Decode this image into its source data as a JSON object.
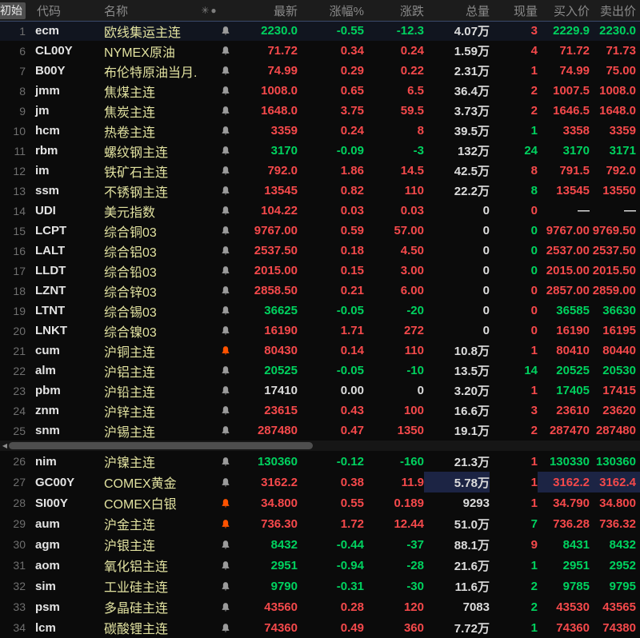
{
  "colors": {
    "up": "#f5494b",
    "down": "#00d25f",
    "neutral": "#dcdcdc",
    "name_text": "#e2e2a0",
    "alert_bell": "#ff5300",
    "highlight_bg": "#1c2444"
  },
  "header": {
    "initial": "初始",
    "code": "代码",
    "name": "名称",
    "mode_icon": "✳●",
    "last": "最新",
    "pct": "涨幅%",
    "chg": "涨跌",
    "vol": "总量",
    "cur": "现量",
    "bid": "买入价",
    "ask": "卖出价"
  },
  "scrollbar": {
    "arrow_left": "◀"
  },
  "rows_top": [
    {
      "num": "1",
      "code": "ecm",
      "name": "欧线集运主连",
      "bell": "normal",
      "selected": true,
      "values": [
        [
          "2230.0",
          "d"
        ],
        [
          "-0.55",
          "d"
        ],
        [
          "-12.3",
          "d"
        ],
        [
          "4.07万",
          "n"
        ],
        [
          "3",
          "u"
        ],
        [
          "2229.9",
          "d"
        ],
        [
          "2230.0",
          "d"
        ]
      ]
    },
    {
      "num": "6",
      "code": "CL00Y",
      "name": "NYMEX原油",
      "bell": "normal",
      "values": [
        [
          "71.72",
          "u"
        ],
        [
          "0.34",
          "u"
        ],
        [
          "0.24",
          "u"
        ],
        [
          "1.59万",
          "n"
        ],
        [
          "4",
          "u"
        ],
        [
          "71.72",
          "u"
        ],
        [
          "71.73",
          "u"
        ]
      ]
    },
    {
      "num": "7",
      "code": "B00Y",
      "name": "布伦特原油当月...",
      "bell": "normal",
      "values": [
        [
          "74.99",
          "u"
        ],
        [
          "0.29",
          "u"
        ],
        [
          "0.22",
          "u"
        ],
        [
          "2.31万",
          "n"
        ],
        [
          "1",
          "u"
        ],
        [
          "74.99",
          "u"
        ],
        [
          "75.00",
          "u"
        ]
      ]
    },
    {
      "num": "8",
      "code": "jmm",
      "name": "焦煤主连",
      "bell": "normal",
      "values": [
        [
          "1008.0",
          "u"
        ],
        [
          "0.65",
          "u"
        ],
        [
          "6.5",
          "u"
        ],
        [
          "36.4万",
          "n"
        ],
        [
          "2",
          "u"
        ],
        [
          "1007.5",
          "u"
        ],
        [
          "1008.0",
          "u"
        ]
      ]
    },
    {
      "num": "9",
      "code": "jm",
      "name": "焦炭主连",
      "bell": "normal",
      "values": [
        [
          "1648.0",
          "u"
        ],
        [
          "3.75",
          "u"
        ],
        [
          "59.5",
          "u"
        ],
        [
          "3.73万",
          "n"
        ],
        [
          "2",
          "u"
        ],
        [
          "1646.5",
          "u"
        ],
        [
          "1648.0",
          "u"
        ]
      ]
    },
    {
      "num": "10",
      "code": "hcm",
      "name": "热卷主连",
      "bell": "normal",
      "values": [
        [
          "3359",
          "u"
        ],
        [
          "0.24",
          "u"
        ],
        [
          "8",
          "u"
        ],
        [
          "39.5万",
          "n"
        ],
        [
          "1",
          "d"
        ],
        [
          "3358",
          "u"
        ],
        [
          "3359",
          "u"
        ]
      ]
    },
    {
      "num": "11",
      "code": "rbm",
      "name": "螺纹钢主连",
      "bell": "normal",
      "values": [
        [
          "3170",
          "d"
        ],
        [
          "-0.09",
          "d"
        ],
        [
          "-3",
          "d"
        ],
        [
          "132万",
          "n"
        ],
        [
          "24",
          "d"
        ],
        [
          "3170",
          "d"
        ],
        [
          "3171",
          "d"
        ]
      ]
    },
    {
      "num": "12",
      "code": "im",
      "name": "铁矿石主连",
      "bell": "normal",
      "values": [
        [
          "792.0",
          "u"
        ],
        [
          "1.86",
          "u"
        ],
        [
          "14.5",
          "u"
        ],
        [
          "42.5万",
          "n"
        ],
        [
          "8",
          "u"
        ],
        [
          "791.5",
          "u"
        ],
        [
          "792.0",
          "u"
        ]
      ]
    },
    {
      "num": "13",
      "code": "ssm",
      "name": "不锈钢主连",
      "bell": "normal",
      "values": [
        [
          "13545",
          "u"
        ],
        [
          "0.82",
          "u"
        ],
        [
          "110",
          "u"
        ],
        [
          "22.2万",
          "n"
        ],
        [
          "8",
          "d"
        ],
        [
          "13545",
          "u"
        ],
        [
          "13550",
          "u"
        ]
      ]
    },
    {
      "num": "14",
      "code": "UDI",
      "name": "美元指数",
      "bell": "normal",
      "values": [
        [
          "104.22",
          "u"
        ],
        [
          "0.03",
          "u"
        ],
        [
          "0.03",
          "u"
        ],
        [
          "0",
          "n"
        ],
        [
          "0",
          "u"
        ],
        [
          "—",
          "n"
        ],
        [
          "—",
          "n"
        ]
      ]
    },
    {
      "num": "15",
      "code": "LCPT",
      "name": "综合铜03",
      "bell": "normal",
      "values": [
        [
          "9767.00",
          "u"
        ],
        [
          "0.59",
          "u"
        ],
        [
          "57.00",
          "u"
        ],
        [
          "0",
          "n"
        ],
        [
          "0",
          "d"
        ],
        [
          "9767.00",
          "u"
        ],
        [
          "9769.50",
          "u"
        ]
      ]
    },
    {
      "num": "16",
      "code": "LALT",
      "name": "综合铝03",
      "bell": "normal",
      "values": [
        [
          "2537.50",
          "u"
        ],
        [
          "0.18",
          "u"
        ],
        [
          "4.50",
          "u"
        ],
        [
          "0",
          "n"
        ],
        [
          "0",
          "d"
        ],
        [
          "2537.00",
          "u"
        ],
        [
          "2537.50",
          "u"
        ]
      ]
    },
    {
      "num": "17",
      "code": "LLDT",
      "name": "综合铅03",
      "bell": "normal",
      "values": [
        [
          "2015.00",
          "u"
        ],
        [
          "0.15",
          "u"
        ],
        [
          "3.00",
          "u"
        ],
        [
          "0",
          "n"
        ],
        [
          "0",
          "d"
        ],
        [
          "2015.00",
          "u"
        ],
        [
          "2015.50",
          "u"
        ]
      ]
    },
    {
      "num": "18",
      "code": "LZNT",
      "name": "综合锌03",
      "bell": "normal",
      "values": [
        [
          "2858.50",
          "u"
        ],
        [
          "0.21",
          "u"
        ],
        [
          "6.00",
          "u"
        ],
        [
          "0",
          "n"
        ],
        [
          "0",
          "u"
        ],
        [
          "2857.00",
          "u"
        ],
        [
          "2859.00",
          "u"
        ]
      ]
    },
    {
      "num": "19",
      "code": "LTNT",
      "name": "综合锡03",
      "bell": "normal",
      "values": [
        [
          "36625",
          "d"
        ],
        [
          "-0.05",
          "d"
        ],
        [
          "-20",
          "d"
        ],
        [
          "0",
          "n"
        ],
        [
          "0",
          "u"
        ],
        [
          "36585",
          "d"
        ],
        [
          "36630",
          "d"
        ]
      ]
    },
    {
      "num": "20",
      "code": "LNKT",
      "name": "综合镍03",
      "bell": "normal",
      "values": [
        [
          "16190",
          "u"
        ],
        [
          "1.71",
          "u"
        ],
        [
          "272",
          "u"
        ],
        [
          "0",
          "n"
        ],
        [
          "0",
          "u"
        ],
        [
          "16190",
          "u"
        ],
        [
          "16195",
          "u"
        ]
      ]
    },
    {
      "num": "21",
      "code": "cum",
      "name": "沪铜主连",
      "bell": "alert",
      "values": [
        [
          "80430",
          "u"
        ],
        [
          "0.14",
          "u"
        ],
        [
          "110",
          "u"
        ],
        [
          "10.8万",
          "n"
        ],
        [
          "1",
          "u"
        ],
        [
          "80410",
          "u"
        ],
        [
          "80440",
          "u"
        ]
      ]
    },
    {
      "num": "22",
      "code": "alm",
      "name": "沪铝主连",
      "bell": "normal",
      "values": [
        [
          "20525",
          "d"
        ],
        [
          "-0.05",
          "d"
        ],
        [
          "-10",
          "d"
        ],
        [
          "13.5万",
          "n"
        ],
        [
          "14",
          "d"
        ],
        [
          "20525",
          "d"
        ],
        [
          "20530",
          "d"
        ]
      ]
    },
    {
      "num": "23",
      "code": "pbm",
      "name": "沪铅主连",
      "bell": "normal",
      "values": [
        [
          "17410",
          "n"
        ],
        [
          "0.00",
          "n"
        ],
        [
          "0",
          "n"
        ],
        [
          "3.20万",
          "n"
        ],
        [
          "1",
          "u"
        ],
        [
          "17405",
          "d"
        ],
        [
          "17415",
          "u"
        ]
      ]
    },
    {
      "num": "24",
      "code": "znm",
      "name": "沪锌主连",
      "bell": "normal",
      "values": [
        [
          "23615",
          "u"
        ],
        [
          "0.43",
          "u"
        ],
        [
          "100",
          "u"
        ],
        [
          "16.6万",
          "n"
        ],
        [
          "3",
          "u"
        ],
        [
          "23610",
          "u"
        ],
        [
          "23620",
          "u"
        ]
      ]
    },
    {
      "num": "25",
      "code": "snm",
      "name": "沪锡主连",
      "bell": "normal",
      "values": [
        [
          "287480",
          "u"
        ],
        [
          "0.47",
          "u"
        ],
        [
          "1350",
          "u"
        ],
        [
          "19.1万",
          "n"
        ],
        [
          "2",
          "u"
        ],
        [
          "287470",
          "u"
        ],
        [
          "287480",
          "u"
        ]
      ]
    }
  ],
  "rows_bottom": [
    {
      "num": "26",
      "code": "nim",
      "name": "沪镍主连",
      "bell": "normal",
      "values": [
        [
          "130360",
          "d"
        ],
        [
          "-0.12",
          "d"
        ],
        [
          "-160",
          "d"
        ],
        [
          "21.3万",
          "n"
        ],
        [
          "1",
          "u"
        ],
        [
          "130330",
          "d"
        ],
        [
          "130360",
          "d"
        ]
      ]
    },
    {
      "num": "27",
      "code": "GC00Y",
      "name": "COMEX黄金",
      "bell": "normal",
      "hl": [
        3,
        5,
        6
      ],
      "values": [
        [
          "3162.2",
          "u"
        ],
        [
          "0.38",
          "u"
        ],
        [
          "11.9",
          "u"
        ],
        [
          "5.78万",
          "n"
        ],
        [
          "1",
          "u"
        ],
        [
          "3162.2",
          "u"
        ],
        [
          "3162.4",
          "u"
        ]
      ]
    },
    {
      "num": "28",
      "code": "SI00Y",
      "name": "COMEX白银",
      "bell": "alert",
      "values": [
        [
          "34.800",
          "u"
        ],
        [
          "0.55",
          "u"
        ],
        [
          "0.189",
          "u"
        ],
        [
          "9293",
          "n"
        ],
        [
          "1",
          "u"
        ],
        [
          "34.790",
          "u"
        ],
        [
          "34.800",
          "u"
        ]
      ]
    },
    {
      "num": "29",
      "code": "aum",
      "name": "沪金主连",
      "bell": "alert",
      "values": [
        [
          "736.30",
          "u"
        ],
        [
          "1.72",
          "u"
        ],
        [
          "12.44",
          "u"
        ],
        [
          "51.0万",
          "n"
        ],
        [
          "7",
          "d"
        ],
        [
          "736.28",
          "u"
        ],
        [
          "736.32",
          "u"
        ]
      ]
    },
    {
      "num": "30",
      "code": "agm",
      "name": "沪银主连",
      "bell": "normal",
      "values": [
        [
          "8432",
          "d"
        ],
        [
          "-0.44",
          "d"
        ],
        [
          "-37",
          "d"
        ],
        [
          "88.1万",
          "n"
        ],
        [
          "9",
          "u"
        ],
        [
          "8431",
          "d"
        ],
        [
          "8432",
          "d"
        ]
      ]
    },
    {
      "num": "31",
      "code": "aom",
      "name": "氧化铝主连",
      "bell": "normal",
      "values": [
        [
          "2951",
          "d"
        ],
        [
          "-0.94",
          "d"
        ],
        [
          "-28",
          "d"
        ],
        [
          "21.6万",
          "n"
        ],
        [
          "1",
          "d"
        ],
        [
          "2951",
          "d"
        ],
        [
          "2952",
          "d"
        ]
      ]
    },
    {
      "num": "32",
      "code": "sim",
      "name": "工业硅主连",
      "bell": "normal",
      "values": [
        [
          "9790",
          "d"
        ],
        [
          "-0.31",
          "d"
        ],
        [
          "-30",
          "d"
        ],
        [
          "11.6万",
          "n"
        ],
        [
          "2",
          "d"
        ],
        [
          "9785",
          "d"
        ],
        [
          "9795",
          "d"
        ]
      ]
    },
    {
      "num": "33",
      "code": "psm",
      "name": "多晶硅主连",
      "bell": "normal",
      "values": [
        [
          "43560",
          "u"
        ],
        [
          "0.28",
          "u"
        ],
        [
          "120",
          "u"
        ],
        [
          "7083",
          "n"
        ],
        [
          "2",
          "d"
        ],
        [
          "43530",
          "u"
        ],
        [
          "43565",
          "u"
        ]
      ]
    },
    {
      "num": "34",
      "code": "lcm",
      "name": "碳酸锂主连",
      "bell": "normal",
      "values": [
        [
          "74360",
          "u"
        ],
        [
          "0.49",
          "u"
        ],
        [
          "360",
          "u"
        ],
        [
          "7.72万",
          "n"
        ],
        [
          "1",
          "d"
        ],
        [
          "74360",
          "u"
        ],
        [
          "74380",
          "u"
        ]
      ]
    }
  ]
}
